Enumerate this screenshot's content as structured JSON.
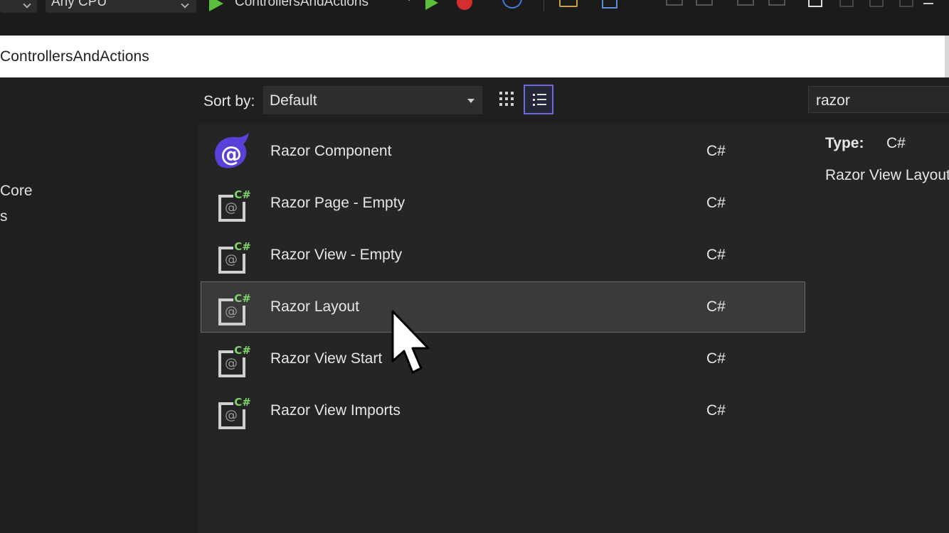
{
  "toolbar": {
    "platform": "Any CPU",
    "startup_project": "ControllersAndActions"
  },
  "window": {
    "title": "ControllersAndActions"
  },
  "left_pane": {
    "items": [
      "Core",
      "s"
    ]
  },
  "sort": {
    "label": "Sort by:",
    "value": "Default"
  },
  "templates": [
    {
      "name": "Razor Component",
      "lang": "C#",
      "icon": "blazor-icon",
      "selected": false
    },
    {
      "name": "Razor Page - Empty",
      "lang": "C#",
      "icon": "razor-file-icon",
      "selected": false
    },
    {
      "name": "Razor View - Empty",
      "lang": "C#",
      "icon": "razor-file-icon",
      "selected": false
    },
    {
      "name": "Razor Layout",
      "lang": "C#",
      "icon": "razor-file-icon",
      "selected": true
    },
    {
      "name": "Razor View Start",
      "lang": "C#",
      "icon": "razor-file-icon",
      "selected": false
    },
    {
      "name": "Razor View Imports",
      "lang": "C#",
      "icon": "razor-file-icon",
      "selected": false
    }
  ],
  "search": {
    "query": "razor"
  },
  "details": {
    "type_label": "Type:",
    "type_value": "C#",
    "description": "Razor View Layout"
  },
  "colors": {
    "accent": "#6b6bd6",
    "csharp_green": "#7fd36a",
    "blazor_purple": "#5b3fd9",
    "run_green": "#5cbf3a"
  }
}
